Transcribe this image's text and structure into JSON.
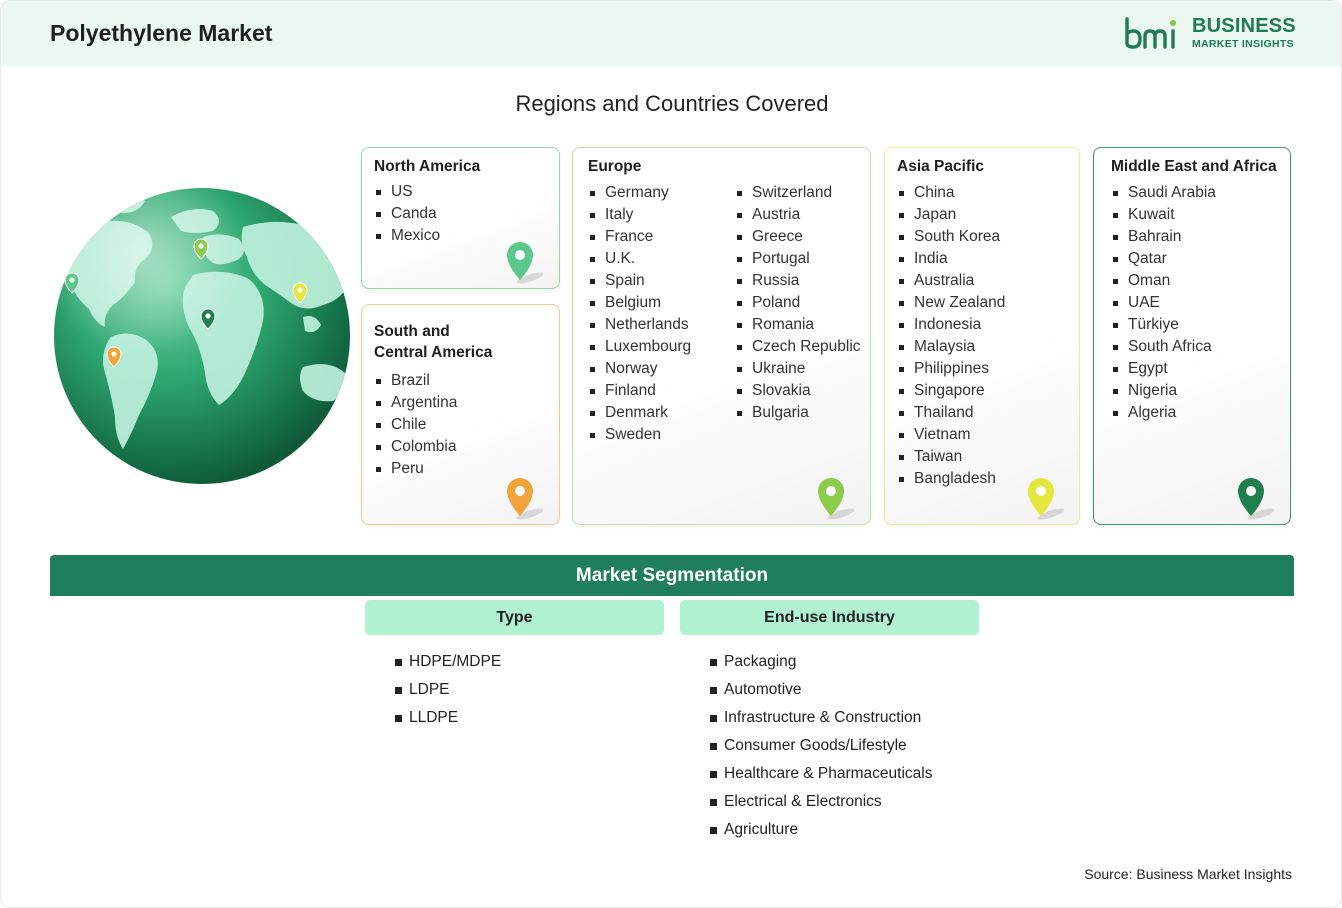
{
  "header": {
    "title": "Polyethylene Market",
    "logo_line1": "BUSINESS",
    "logo_line2": "MARKET INSIGHTS"
  },
  "regions_title": "Regions and Countries Covered",
  "regions": [
    {
      "name": "North America",
      "color": "#5cc98c",
      "countries": [
        "US",
        "Canda",
        "Mexico"
      ]
    },
    {
      "name": "South and Central America",
      "name_line1": "South and",
      "name_line2": "Central America",
      "color": "#f2a33a",
      "countries": [
        "Brazil",
        "Argentina",
        "Chile",
        "Colombia",
        "Peru"
      ]
    },
    {
      "name": "Europe",
      "color": "#8ccc4a",
      "countries_col1": [
        "Germany",
        "Italy",
        "France",
        "U.K.",
        "Spain",
        "Belgium",
        "Netherlands",
        "Luxembourg",
        "Norway",
        "Finland",
        "Denmark",
        "Sweden"
      ],
      "countries_col2": [
        "Switzerland",
        "Austria",
        "Greece",
        "Portugal",
        "Russia",
        "Poland",
        "Romania",
        "Czech Republic",
        "Ukraine",
        "Slovakia",
        "Bulgaria"
      ]
    },
    {
      "name": "Asia Pacific",
      "color": "#e3e83a",
      "countries": [
        "China",
        "Japan",
        "South Korea",
        "India",
        "Australia",
        "New Zealand",
        "Indonesia",
        "Malaysia",
        "Philippines",
        "Singapore",
        "Thailand",
        "Vietnam",
        "Taiwan",
        "Bangladesh"
      ]
    },
    {
      "name": "Middle East and Africa",
      "color": "#1f7f4f",
      "countries": [
        "Saudi Arabia",
        "Kuwait",
        "Bahrain",
        "Qatar",
        "Oman",
        "UAE",
        "Türkiye",
        "South Africa",
        "Egypt",
        "Nigeria",
        "Algeria"
      ]
    }
  ],
  "segmentation": {
    "title": "Market Segmentation",
    "columns": [
      {
        "heading": "Type",
        "items": [
          "HDPE/MDPE",
          "LDPE",
          "LLDPE"
        ]
      },
      {
        "heading": "End-use Industry",
        "items": [
          "Packaging",
          "Automotive",
          "Infrastructure & Construction",
          "Consumer Goods/Lifestyle",
          "Healthcare & Pharmaceuticals",
          "Electrical & Electronics",
          "Agriculture"
        ]
      }
    ]
  },
  "source": "Source: Business Market Insights",
  "icons": {
    "globe": "globe-map-icon",
    "pin": "location-pin-icon",
    "logo": "bmi-logo-icon"
  }
}
